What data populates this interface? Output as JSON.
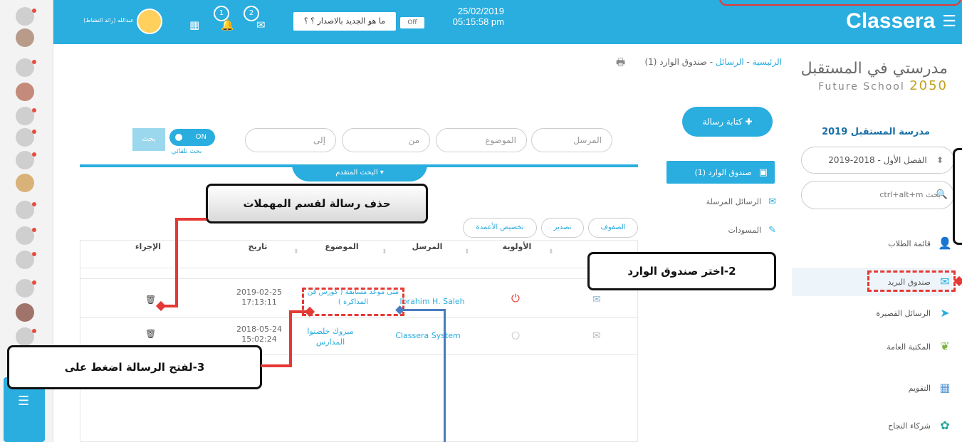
{
  "app": {
    "brand": "Classera",
    "menu_icon": "hamburger-icon"
  },
  "header": {
    "date": "25/02/2019",
    "time": "05:15:58 pm",
    "toggle": "Off",
    "whats_new": "ما هو الجديد بالاصدار ؟ ؟",
    "notifications_count": "1",
    "messages_count": "2",
    "user_name": "عبدالله (رائد النشاط)"
  },
  "sidebar": {
    "school_logo_line1": "مدرستي في المستقبل",
    "school_logo_line2": "Future School",
    "school_logo_year": "2050",
    "school_name": "مدرسة المستقبل 2019",
    "term_select": "الفصل الأول - 2018-2019",
    "search_placeholder": "ctrl+alt+m بحث",
    "items": [
      {
        "label": "قائمة الطلاب",
        "icon": "user-icon"
      },
      {
        "label": "صندوق البريد",
        "icon": "mail-icon"
      },
      {
        "label": "الرسائل القصيرة",
        "icon": "send-icon"
      },
      {
        "label": "المكتبة العامة",
        "icon": "leaf-icon"
      },
      {
        "label": "التقويم",
        "icon": "calendar-icon"
      },
      {
        "label": "شركاء النجاح",
        "icon": "partners-icon"
      }
    ]
  },
  "breadcrumb": {
    "home": "الرئيسية",
    "messages": "الرسائل",
    "current": "صندوق الوارد (1)",
    "sep": " - "
  },
  "compose_label": "كتابة رسالة",
  "filters": {
    "sender": "المرسل",
    "subject": "الموضوع",
    "from": "من",
    "to": "إلى",
    "switch": "ON",
    "auto_search": "بحث تلقائي",
    "search_button": "بحث",
    "advanced": "البحث المتقدم"
  },
  "folders": [
    {
      "label": "صندوق الوارد (1)",
      "icon": "inbox-icon"
    },
    {
      "label": "الرسائل المرسلة",
      "icon": "envelope-icon"
    },
    {
      "label": "المسودات",
      "icon": "edit-icon"
    }
  ],
  "table_buttons": {
    "rows": "الصفوف",
    "export": "تصدير",
    "columns": "تخصيص الأعمدة"
  },
  "table": {
    "columns": [
      "الأولوية",
      "المرسل",
      "الموضوع",
      "تاريخ",
      "الإجراء"
    ],
    "rows": [
      {
        "priority": "high",
        "sender": "Ibrahim H. Saleh",
        "subject": "متى موعد مسابقة ( كورس فن المذاكرة )",
        "date": "2019-02-25",
        "time": "17:13:11"
      },
      {
        "priority": "low",
        "sender": "Classera System",
        "subject": "مبروك خلصتوا المدارس",
        "date": "2018-05-24",
        "time": "15:02:24"
      }
    ]
  },
  "annotations": {
    "delete": "حذف رسالة لقسم المهملات",
    "choose_inbox": "2-اختر صندوق الوارد",
    "open_message": "3-لفتح الرسالة اضغط على"
  }
}
